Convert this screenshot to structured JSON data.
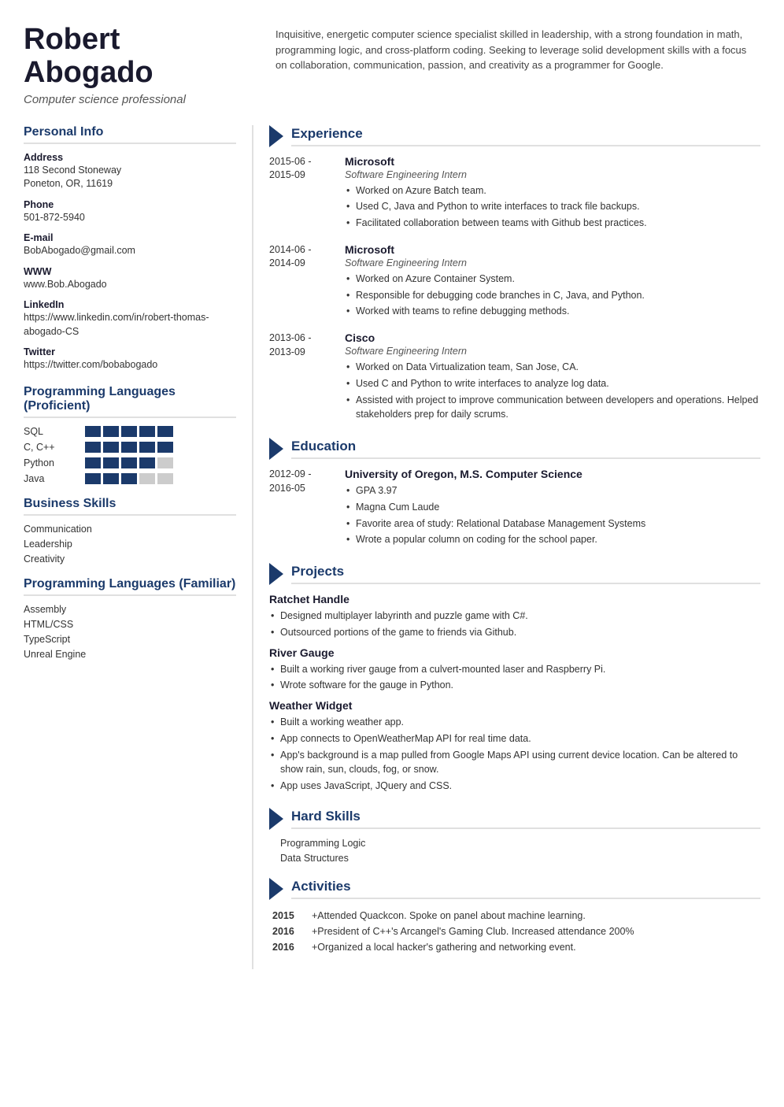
{
  "header": {
    "name": "Robert Abogado",
    "subtitle": "Computer science professional",
    "summary": "Inquisitive, energetic computer science specialist skilled in leadership, with a strong foundation in math, programming logic, and cross-platform coding. Seeking to leverage solid development skills with a focus on collaboration, communication, passion, and creativity as a programmer for Google."
  },
  "personal_info": {
    "title": "Personal Info",
    "address_label": "Address",
    "address_value": "118 Second Stoneway\nPoneton, OR, 11619",
    "phone_label": "Phone",
    "phone_value": "501-872-5940",
    "email_label": "E-mail",
    "email_value": "BobAbogado@gmail.com",
    "www_label": "WWW",
    "www_value": "www.Bob.Abogado",
    "linkedin_label": "LinkedIn",
    "linkedin_value": "https://www.linkedin.com/in/robert-thomas-abogado-CS",
    "twitter_label": "Twitter",
    "twitter_value": "https://twitter.com/bobabogado"
  },
  "programming_proficient": {
    "title": "Programming Languages (Proficient)",
    "skills": [
      {
        "name": "SQL",
        "filled": 5,
        "empty": 0
      },
      {
        "name": "C, C++",
        "filled": 5,
        "empty": 0
      },
      {
        "name": "Python",
        "filled": 4,
        "empty": 1
      },
      {
        "name": "Java",
        "filled": 3,
        "empty": 2
      }
    ]
  },
  "business_skills": {
    "title": "Business Skills",
    "items": [
      "Communication",
      "Leadership",
      "Creativity"
    ]
  },
  "programming_familiar": {
    "title": "Programming Languages (Familiar)",
    "items": [
      "Assembly",
      "HTML/CSS",
      "TypeScript",
      "Unreal Engine"
    ]
  },
  "experience": {
    "title": "Experience",
    "entries": [
      {
        "date": "2015-06 -\n2015-09",
        "company": "Microsoft",
        "role": "Software Engineering Intern",
        "bullets": [
          "Worked on Azure Batch team.",
          "Used C, Java and Python to write interfaces to track file backups.",
          "Facilitated collaboration between teams with Github best practices."
        ]
      },
      {
        "date": "2014-06 -\n2014-09",
        "company": "Microsoft",
        "role": "Software Engineering Intern",
        "bullets": [
          "Worked on Azure Container System.",
          "Responsible for debugging code branches in C, Java, and Python.",
          "Worked with teams to refine debugging methods."
        ]
      },
      {
        "date": "2013-06 -\n2013-09",
        "company": "Cisco",
        "role": "Software Engineering Intern",
        "bullets": [
          "Worked on Data Virtualization team, San Jose, CA.",
          "Used C and Python to write interfaces to analyze log data.",
          "Assisted with project to improve communication between developers and operations. Helped stakeholders prep for daily scrums."
        ]
      }
    ]
  },
  "education": {
    "title": "Education",
    "entries": [
      {
        "date": "2012-09 -\n2016-05",
        "school": "University of Oregon, M.S. Computer Science",
        "bullets": [
          "GPA 3.97",
          "Magna Cum Laude",
          "Favorite area of study: Relational Database Management Systems",
          "Wrote a popular column on coding for the school paper."
        ]
      }
    ]
  },
  "projects": {
    "title": "Projects",
    "items": [
      {
        "name": "Ratchet Handle",
        "bullets": [
          "Designed multiplayer labyrinth and puzzle game with C#.",
          "Outsourced portions of the game to friends via Github."
        ]
      },
      {
        "name": "River Gauge",
        "bullets": [
          "Built a working river gauge from a culvert-mounted laser and Raspberry Pi.",
          "Wrote software for the gauge in Python."
        ]
      },
      {
        "name": "Weather Widget",
        "bullets": [
          "Built a working weather app.",
          "App connects to OpenWeatherMap API for real time data.",
          "App's background is a map pulled from Google Maps API using current device location. Can be altered to show rain, sun, clouds, fog, or snow.",
          "App uses JavaScript, JQuery and CSS."
        ]
      }
    ]
  },
  "hard_skills": {
    "title": "Hard Skills",
    "items": [
      "Programming Logic",
      "Data Structures"
    ]
  },
  "activities": {
    "title": "Activities",
    "items": [
      {
        "year": "2015",
        "description": "+Attended Quackcon. Spoke on panel about machine learning."
      },
      {
        "year": "2016",
        "description": "+President of C++'s Arcangel's Gaming Club. Increased attendance 200%"
      },
      {
        "year": "2016",
        "description": "+Organized a local hacker's gathering and networking event."
      }
    ]
  }
}
